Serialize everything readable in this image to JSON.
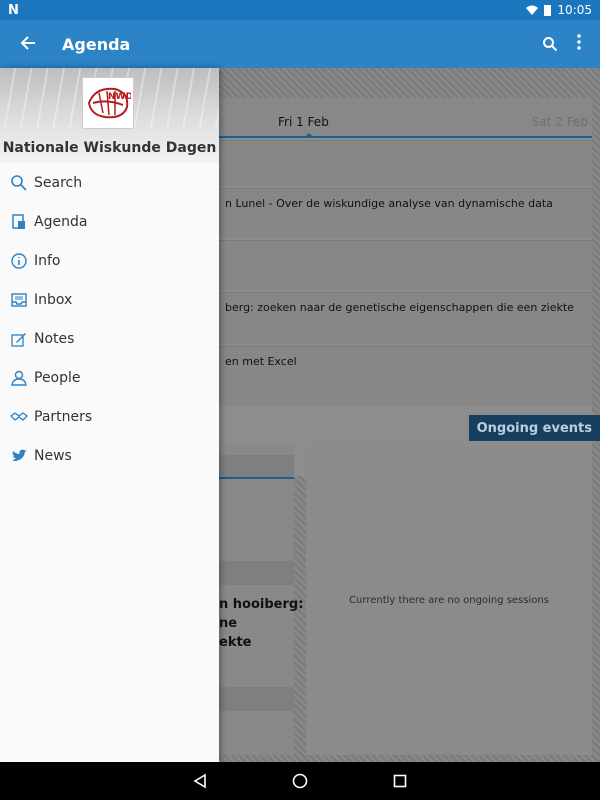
{
  "statusbar": {
    "left_icon": "N",
    "time": "10:05"
  },
  "appbar": {
    "title": "Agenda"
  },
  "tabs": {
    "current": "Fri 1 Feb",
    "next": "Sat 2 Feb"
  },
  "sessions": [
    {
      "text": ""
    },
    {
      "text": "n Lunel - Over de wiskundige analyse van dynamische data"
    },
    {
      "text": ""
    },
    {
      "text": "berg: zoeken naar de genetische eigenschappen die een ziekte"
    },
    {
      "text": "en met Excel"
    }
  ],
  "ongoing": {
    "label": "Ongoing events",
    "empty": "Currently there are no ongoing sessions"
  },
  "left_panel": {
    "line1": "n hooiberg:",
    "line2": "ne",
    "line3": "ekte"
  },
  "drawer": {
    "title": "Nationale Wiskunde Dagen",
    "logo_text": "NWD",
    "items": [
      {
        "label": "Search",
        "icon": "search-icon"
      },
      {
        "label": "Agenda",
        "icon": "agenda-icon"
      },
      {
        "label": "Info",
        "icon": "info-icon"
      },
      {
        "label": "Inbox",
        "icon": "inbox-icon"
      },
      {
        "label": "Notes",
        "icon": "notes-icon"
      },
      {
        "label": "People",
        "icon": "people-icon"
      },
      {
        "label": "Partners",
        "icon": "partners-icon"
      },
      {
        "label": "News",
        "icon": "news-icon"
      }
    ]
  },
  "colors": {
    "primary": "#2c83c5",
    "status": "#1a76bd",
    "icon": "#2c83c5"
  }
}
